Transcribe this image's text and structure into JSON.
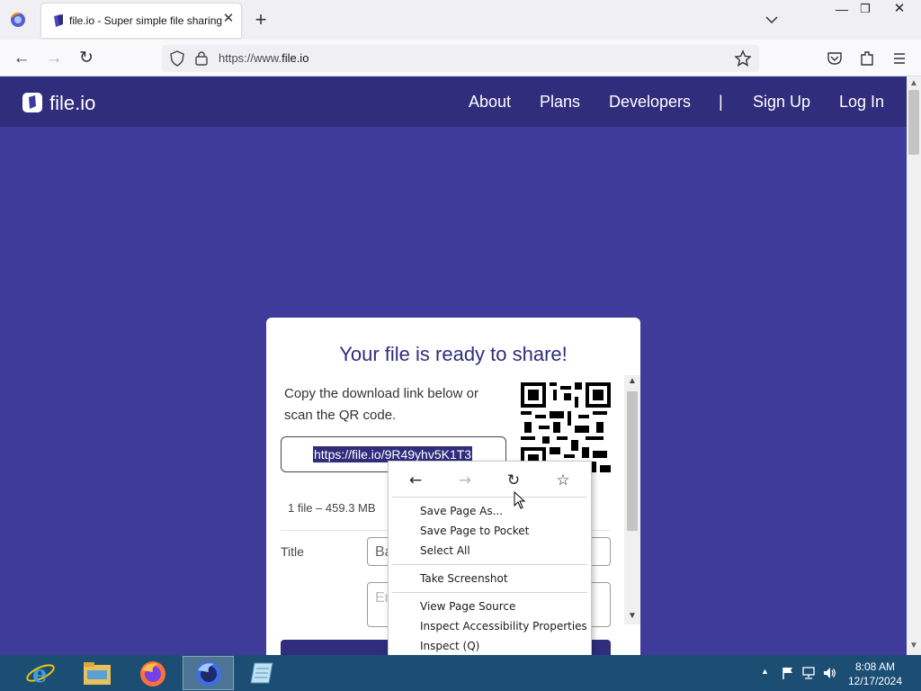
{
  "browser": {
    "tab": {
      "title": "file.io - Super simple file sharing",
      "close_glyph": "✕"
    },
    "new_tab_glyph": "+",
    "window": {
      "minimize": "—",
      "maximize": "❐",
      "close": "✕"
    },
    "nav": {
      "back": "←",
      "forward": "→",
      "reload": "↻"
    },
    "url": {
      "prefix": "https://www.",
      "domain": "file.io"
    }
  },
  "site": {
    "logo_text": "file.io",
    "nav": [
      {
        "label": "About"
      },
      {
        "label": "Plans"
      },
      {
        "label": "Developers"
      },
      {
        "label": "|"
      },
      {
        "label": "Sign Up"
      },
      {
        "label": "Log In"
      }
    ]
  },
  "card": {
    "title": "Your file is ready to share!",
    "description": "Copy the download link below or scan the QR code.",
    "link": "https://file.io/9R49yhv5K1T3",
    "file_info": "1 file – 459.3 MB",
    "title_label": "Title",
    "title_value": "Ba",
    "desc_placeholder": "En"
  },
  "context_menu": {
    "nav": {
      "back": "←",
      "forward": "→",
      "reload": "↻",
      "bookmark": "☆"
    },
    "items": [
      {
        "label": "Save Page As..."
      },
      {
        "label": "Save Page to Pocket"
      },
      {
        "label": "Select All"
      },
      {
        "label": "Take Screenshot"
      },
      {
        "label": "View Page Source"
      },
      {
        "label": "Inspect Accessibility Properties"
      },
      {
        "label": "Inspect (Q)"
      }
    ]
  },
  "taskbar": {
    "clock": {
      "time": "8:08 AM",
      "date": "12/17/2024"
    }
  },
  "colors": {
    "page_bg": "#3f3b9b",
    "header_bg": "#2f2d7c",
    "accent": "#2f2d7c",
    "taskbar": "#1c4e74"
  }
}
